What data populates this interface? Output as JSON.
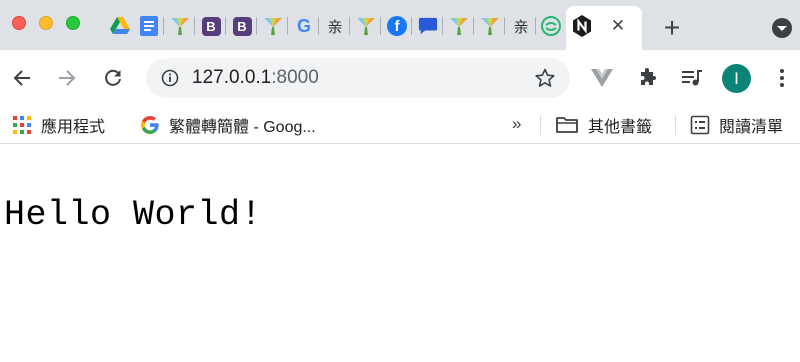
{
  "tabstrip": {
    "favicons": [
      "google-drive-icon",
      "google-docs-icon",
      "yii-icon",
      "bootstrap-icon",
      "bootstrap-icon",
      "yii-icon",
      "google-icon",
      "chinese-char-icon",
      "yii-icon",
      "facebook-icon",
      "chat-bubble-icon",
      "yii-icon",
      "yii-icon",
      "chinese-char-icon",
      "frog-icon"
    ],
    "active_tab": {
      "favicon": "nginx-icon",
      "close_glyph": "✕"
    },
    "bootstrap_letter": "B",
    "google_letter": "G",
    "chinese_char": "亲",
    "facebook_letter": "f",
    "new_tab_glyph": "+",
    "colors": {
      "strip": "#dee1e6",
      "active": "#ffffff"
    }
  },
  "toolbar": {
    "back_icon": "back-arrow-icon",
    "forward_icon": "forward-arrow-icon",
    "reload_icon": "reload-icon",
    "url_host": "127.0.0.1",
    "url_port": ":8000",
    "bookmark_star_icon": "star-icon",
    "extensions": [
      "vue-devtools-icon",
      "puzzle-icon",
      "media-queue-icon"
    ],
    "avatar_letter": "I",
    "avatar_color": "#0b8477",
    "menu_icon": "kebab-menu-icon"
  },
  "bookmarks": {
    "apps_label": "應用程式",
    "google_translate_label": "繁體轉簡體 - Goog...",
    "overflow_glyph": "»",
    "other_bookmarks_label": "其他書籤",
    "reading_list_label": "閱讀清單"
  },
  "page": {
    "heading": "Hello World!"
  }
}
